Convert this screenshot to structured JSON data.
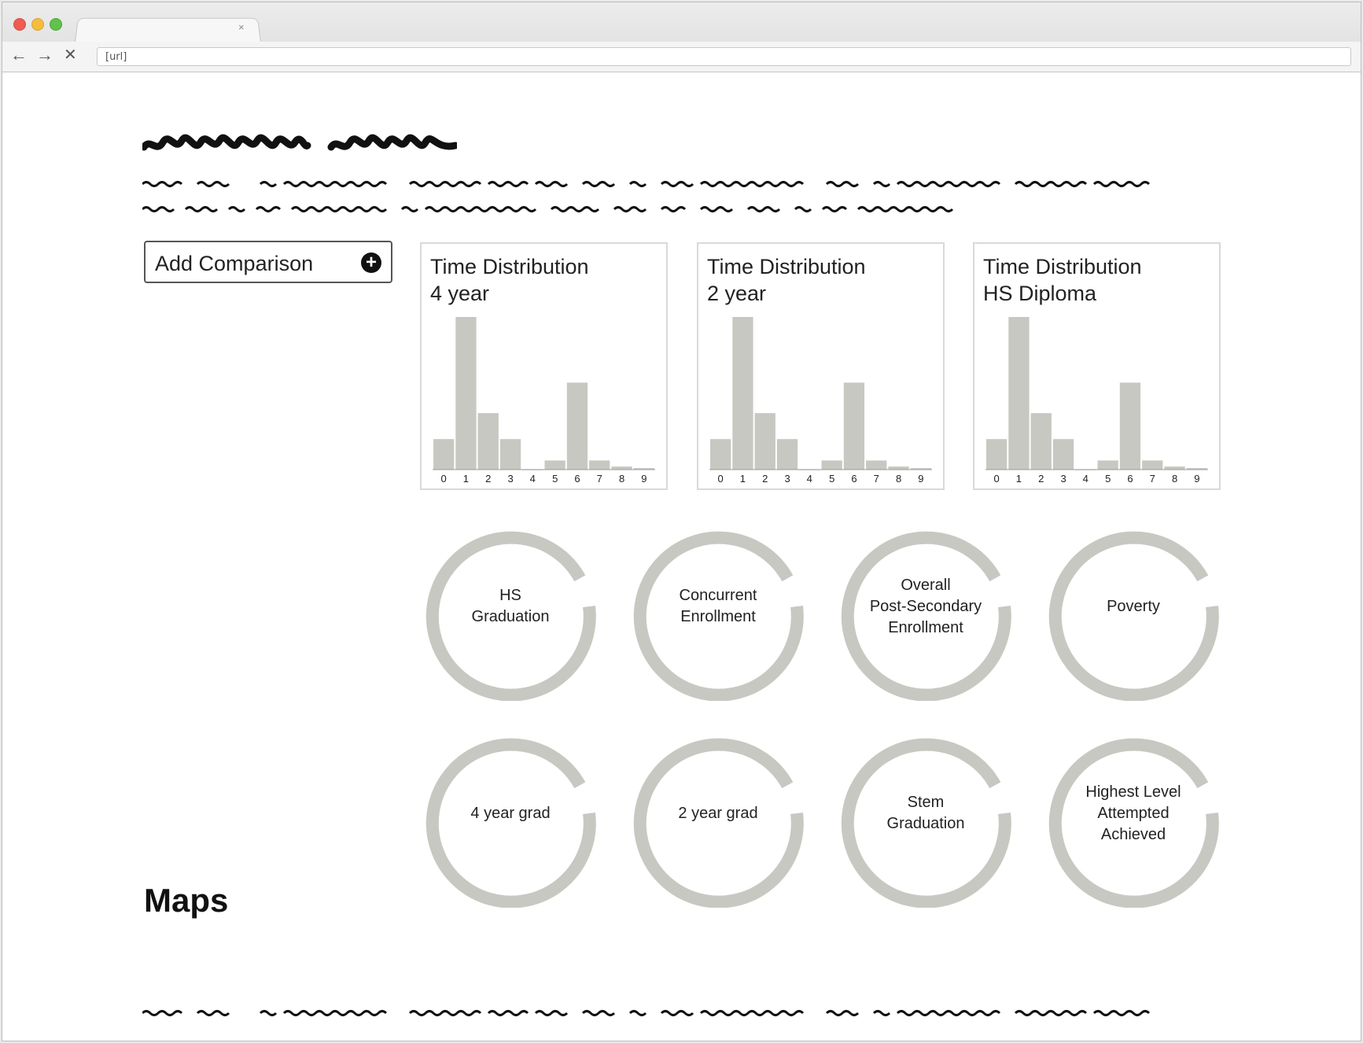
{
  "browser": {
    "tab_close_glyph": "×",
    "back_icon": "←",
    "forward_icon": "→",
    "stop_icon": "✕",
    "url": "[url]"
  },
  "sidebar": {
    "add_comparison_label": "Add Comparison",
    "add_icon_glyph": "+"
  },
  "histograms": [
    {
      "title_line1": "Time Distribution",
      "title_line2": "4 year",
      "chart_data": {
        "type": "bar",
        "categories": [
          "0",
          "1",
          "2",
          "3",
          "4",
          "5",
          "6",
          "7",
          "8",
          "9"
        ],
        "values": [
          20,
          100,
          37,
          20,
          0,
          6,
          57,
          6,
          2,
          1
        ],
        "ylim": [
          0,
          100
        ]
      }
    },
    {
      "title_line1": "Time Distribution",
      "title_line2": "2 year",
      "chart_data": {
        "type": "bar",
        "categories": [
          "0",
          "1",
          "2",
          "3",
          "4",
          "5",
          "6",
          "7",
          "8",
          "9"
        ],
        "values": [
          20,
          100,
          37,
          20,
          0,
          6,
          57,
          6,
          2,
          1
        ],
        "ylim": [
          0,
          100
        ]
      }
    },
    {
      "title_line1": "Time Distribution",
      "title_line2": "HS Diploma",
      "chart_data": {
        "type": "bar",
        "categories": [
          "0",
          "1",
          "2",
          "3",
          "4",
          "5",
          "6",
          "7",
          "8",
          "9"
        ],
        "values": [
          20,
          100,
          37,
          20,
          0,
          6,
          57,
          6,
          2,
          1
        ],
        "ylim": [
          0,
          100
        ]
      }
    }
  ],
  "donuts": [
    {
      "label": "HS\nGraduation"
    },
    {
      "label": "Concurrent\nEnrollment"
    },
    {
      "label": "Overall\nPost-Secondary\nEnrollment"
    },
    {
      "label": "Poverty"
    },
    {
      "label": "4 year grad"
    },
    {
      "label": "2 year grad"
    },
    {
      "label": "Stem\nGraduation"
    },
    {
      "label": "Highest Level\nAttempted\nAchieved"
    }
  ],
  "maps": {
    "title": "Maps"
  },
  "colors": {
    "bar": "#c8c8c2",
    "ring": "#c8c8c2",
    "scribble": "#111111"
  }
}
